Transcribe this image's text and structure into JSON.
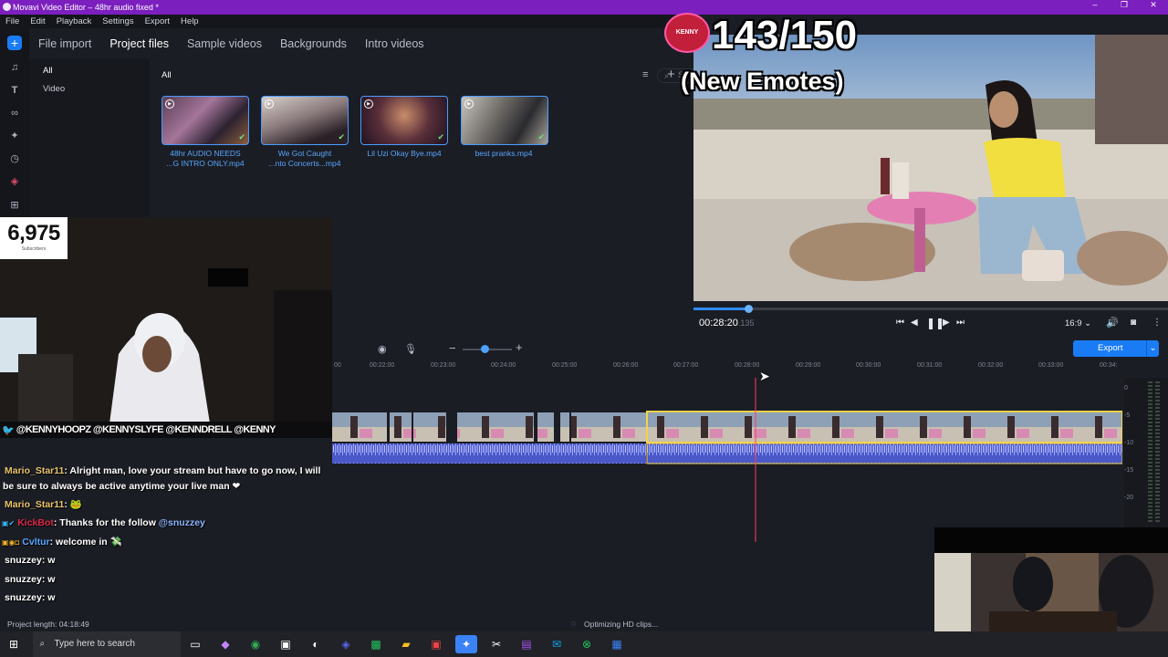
{
  "window": {
    "title": "Movavi Video Editor – 48hr audio fixed *",
    "controls": [
      "–",
      "❐",
      "✕"
    ]
  },
  "menu": [
    "File",
    "Edit",
    "Playback",
    "Settings",
    "Export",
    "Help"
  ],
  "import_tabs": [
    {
      "label": "File import",
      "active": false
    },
    {
      "label": "Project files",
      "active": true
    },
    {
      "label": "Sample videos",
      "active": false
    },
    {
      "label": "Backgrounds",
      "active": false
    },
    {
      "label": "Intro videos",
      "active": false
    }
  ],
  "categories": [
    "All",
    "Video"
  ],
  "media_header": "All",
  "search": {
    "placeholder": "Search"
  },
  "media_files": [
    {
      "name": "48hr AUDIO NEEDS ...G INTRO ONLY.mp4",
      "line1": "48hr AUDIO NEEDS",
      "line2": "...G INTRO ONLY.mp4"
    },
    {
      "name": "We Got Caught ...nto Concerts...mp4",
      "line1": "We Got Caught",
      "line2": "...nto Concerts...mp4"
    },
    {
      "name": "Lil Uzi Okay Bye.mp4",
      "line1": "Lil Uzi Okay Bye.mp4",
      "line2": ""
    },
    {
      "name": "best pranks.mp4",
      "line1": "best pranks.mp4",
      "line2": ""
    }
  ],
  "overlay": {
    "emote_count": "143/150",
    "emote_label": "(New Emotes)",
    "subscriber_count": "6,975",
    "subscriber_label": "Subscribers",
    "social_handles": "@KENNYHOOPZ @KENNYSLYFE @KENNDRELL @KENNY"
  },
  "player": {
    "timecode": "00:28:20",
    "timecode_frames": ".135",
    "progress": 0.115,
    "aspect_ratio": "16:9"
  },
  "timeline": {
    "export_label": "Export",
    "ruler_ticks": [
      "00",
      "00:22:00",
      "00:23:00",
      "00:24:00",
      "00:25:00",
      "00:26:00",
      "00:27:00",
      "00:28:00",
      "00:29:00",
      "00:30:00",
      "00:31:00",
      "00:32:00",
      "00:33:00",
      "00:34:"
    ],
    "meter_labels": [
      "0",
      "-5",
      "-10",
      "-15",
      "-20"
    ]
  },
  "chat": [
    {
      "user": "Mario_Star11",
      "color": "#e8c36a",
      "text": ": Alright man, love your stream but have to go now, I will",
      "badges": ""
    },
    {
      "user": "",
      "color": "#ffffff",
      "text": "be sure to always be active anytime your live man ❤",
      "badges": ""
    },
    {
      "user": "Mario_Star11",
      "color": "#e8c36a",
      "text": ": 🐸",
      "badges": ""
    },
    {
      "user": "KickBot",
      "color": "#e0274b",
      "text": ": Thanks for the follow ",
      "mention": "@snuzzey",
      "badges": "▣✔"
    },
    {
      "user": "Cvltur",
      "color": "#58a6ff",
      "text": ": welcome in 💸",
      "badges": "▣◉◘"
    },
    {
      "user": "snuzzey",
      "color": "#e8e8e8",
      "text": ": w",
      "badges": ""
    },
    {
      "user": "snuzzey",
      "color": "#e8e8e8",
      "text": ": w",
      "badges": ""
    },
    {
      "user": "snuzzey",
      "color": "#e8e8e8",
      "text": ": w",
      "badges": ""
    }
  ],
  "status": {
    "project_length": "Project length: 04:18:49",
    "task": "Optimizing HD clips..."
  },
  "taskbar": {
    "search_placeholder": "Type here to search",
    "apps": [
      "task-view",
      "copilot",
      "chrome",
      "store",
      "obs",
      "discord",
      "app-green",
      "file-explorer",
      "app-red",
      "movavi",
      "capcut",
      "app-purple",
      "outlook",
      "xbox",
      "app-blue"
    ]
  }
}
